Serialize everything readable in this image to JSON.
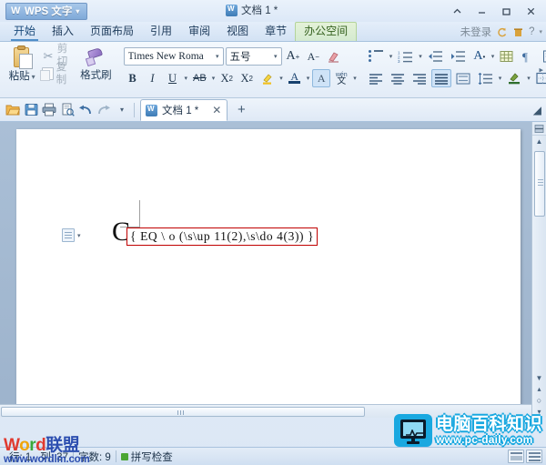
{
  "titlebar": {
    "app_button": "WPS 文字",
    "app_logo_glyph": "W",
    "document_title": "文档 1 *",
    "window_controls": {
      "collapse": "⌃",
      "minimize": "─",
      "maximize": "☐",
      "close": "✕"
    }
  },
  "ribbon_tabs": {
    "items": [
      {
        "label": "开始",
        "active": true
      },
      {
        "label": "插入",
        "active": false
      },
      {
        "label": "页面布局",
        "active": false
      },
      {
        "label": "引用",
        "active": false
      },
      {
        "label": "审阅",
        "active": false
      },
      {
        "label": "视图",
        "active": false
      },
      {
        "label": "章节",
        "active": false
      },
      {
        "label": "办公空间",
        "active": false,
        "highlight": true
      }
    ],
    "right": {
      "login_status": "未登录",
      "help_label": "?",
      "help_caret": "▾"
    }
  },
  "ribbon": {
    "clipboard": {
      "paste_label": "粘贴",
      "paste_caret": "▾",
      "cut_label": "剪切",
      "copy_label": "复制",
      "format_painter_label": "格式刷"
    },
    "font": {
      "font_name": "Times New Roma",
      "font_size": "五号",
      "grow_font": "A",
      "shrink_font": "A",
      "clear_format": "clear-format-icon",
      "bold": "B",
      "italic": "I",
      "underline": "U",
      "strikethrough": "AB",
      "superscript": "X",
      "superscript_exp": "2",
      "subscript": "X",
      "subscript_exp": "2",
      "highlight": "highlight-icon",
      "font_color": "A",
      "char_shading": "A",
      "pinyin_wen": "文",
      "caret": "▾"
    },
    "paragraph": {
      "bullets": "bullet-list-icon",
      "numbering": "numbered-list-icon",
      "decrease_indent": "decrease-indent-icon",
      "increase_indent": "increase-indent-icon",
      "pinyin_guide": "A",
      "borders_table": "table-borders-icon",
      "show_marks": "show-formatting-marks-icon",
      "align_left": "align-left-icon",
      "align_center": "align-center-icon",
      "align_right": "align-right-icon",
      "align_justify": "align-justify-icon",
      "align_distribute": "align-distributed-icon",
      "line_spacing": "line-spacing-icon",
      "shading": "shading-icon",
      "borders": "borders-icon",
      "expand": "▸"
    }
  },
  "quick_access": {
    "open": "open-folder-icon",
    "save": "save-icon",
    "print": "print-icon",
    "print_preview": "print-preview-icon",
    "undo": "undo-icon",
    "redo": "redo-icon",
    "customize_caret": "▾",
    "doc_tab_label": "文档 1 *",
    "doc_tab_close": "✕",
    "new_tab": "+",
    "tab_menu": "◢"
  },
  "document": {
    "drop_cap": "C",
    "field_code": "{ EQ \\ o (\\s\\up 11(2),\\s\\do 4(3)) }",
    "smart_tag": "paste-options-icon",
    "smart_tag_caret": "▾"
  },
  "scrollbars": {
    "v_up": "▲",
    "v_down": "▼",
    "v_prev_page": "▴",
    "v_select_object": "○",
    "v_next_page": "▾",
    "v_top_icon": "split-bar-icon"
  },
  "statusbar": {
    "line_label": "行: 1",
    "column_label": "列: 37",
    "word_count": "字数: 9",
    "spell_check": "拼写检查",
    "view_buttons": [
      "page-view-icon",
      "outline-view-icon"
    ]
  },
  "watermarks": {
    "wordlm": {
      "brand_parts": [
        {
          "text": "W",
          "color": "#e03a2f"
        },
        {
          "text": "o",
          "color": "#f0a50a"
        },
        {
          "text": "r",
          "color": "#3aa83a"
        },
        {
          "text": "d",
          "color": "#e03a2f"
        },
        {
          "text": "联盟",
          "color": "#2d4fb0"
        }
      ],
      "url": "www.wordlm.com"
    },
    "pcdaily": {
      "title": "电脑百科知识",
      "url": "www.pc-daily.com",
      "color": "#19a8e0"
    }
  },
  "colors": {
    "accent": "#4f8ec9",
    "field_border": "#c00000",
    "green_tab": "#35611f",
    "spell_ok": "#4aa533"
  }
}
